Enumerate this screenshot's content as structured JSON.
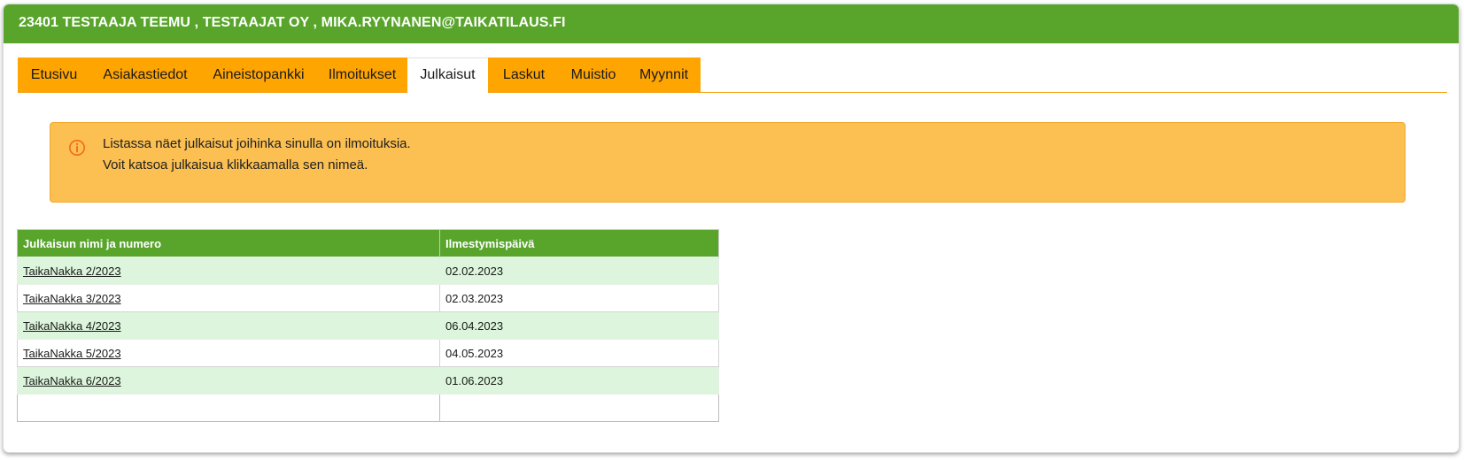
{
  "header": {
    "title": "23401 TESTAAJA TEEMU , TESTAAJAT OY , MIKA.RYYNANEN@TAIKATILAUS.FI"
  },
  "tabs": [
    {
      "label": "Etusivu",
      "active": false
    },
    {
      "label": "Asiakastiedot",
      "active": false
    },
    {
      "label": "Aineistopankki",
      "active": false
    },
    {
      "label": "Ilmoitukset",
      "active": false
    },
    {
      "label": "Julkaisut",
      "active": true
    },
    {
      "label": "Laskut",
      "active": false
    },
    {
      "label": "Muistio",
      "active": false
    },
    {
      "label": "Myynnit",
      "active": false
    }
  ],
  "notice": {
    "icon": "info-circle-icon",
    "line1": "Listassa näet julkaisut joihinka sinulla on ilmoituksia.",
    "line2": "Voit katsoa julkaisua klikkaamalla sen nimeä."
  },
  "table": {
    "headers": [
      "Julkaisun nimi ja numero",
      "Ilmestymispäivä"
    ],
    "rows": [
      {
        "name": "TaikaNakka 2/2023",
        "date": "02.02.2023"
      },
      {
        "name": "TaikaNakka 3/2023",
        "date": "02.03.2023"
      },
      {
        "name": "TaikaNakka 4/2023",
        "date": "06.04.2023"
      },
      {
        "name": "TaikaNakka 5/2023",
        "date": "04.05.2023"
      },
      {
        "name": "TaikaNakka 6/2023",
        "date": "01.06.2023"
      }
    ]
  },
  "colors": {
    "header_green": "#59a52c",
    "tab_orange": "#ffa502",
    "notice_orange": "#fbbf52",
    "row_green": "#dcf5dc",
    "icon_orange": "#f26a1b"
  }
}
